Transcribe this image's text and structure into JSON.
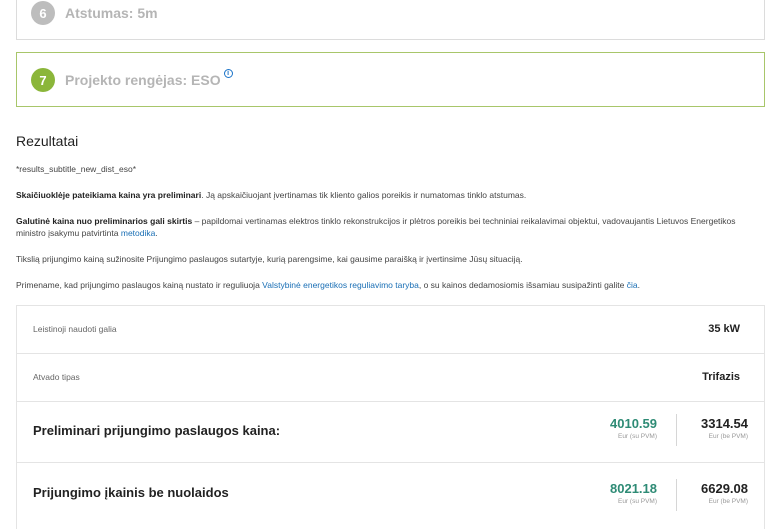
{
  "steps": [
    {
      "number": "6",
      "title": "Atstumas: 5m"
    },
    {
      "number": "7",
      "title": "Projekto rengėjas: ESO",
      "info_icon": "i"
    }
  ],
  "results": {
    "title": "Rezultatai",
    "subtitle": "*results_subtitle_new_dist_eso*",
    "p1_bold": "Skaičiuoklėje pateikiama kaina yra preliminari",
    "p1_text": ". Ją apskaičiuojant įvertinamas tik kliento galios poreikis ir numatomas tinklo atstumas.",
    "p2_bold": "Galutinė kaina nuo preliminarios gali skirtis",
    "p2_text": " – papildomai vertinamas elektros tinklo rekonstrukcijos ir plėtros poreikis bei techniniai reikalavimai objektui, vadovaujantis Lietuvos Energetikos ministro įsakymu patvirtinta ",
    "p2_link": "metodika",
    "p2_end": ".",
    "p3_text": "Tikslią prijungimo kainą sužinosite Prijungimo paslaugos sutartyje, kurią parengsime, kai gausime paraišką ir įvertinsime Jūsų situaciją.",
    "p4_text": "Primename, kad prijungimo paslaugos kainą nustato ir reguliuoja ",
    "p4_link": "Valstybinė energetikos reguliavimo taryba",
    "p4_mid": ", o su kainos dedamosiomis išsamiau susipažinti galite ",
    "p4_link2": "čia",
    "p4_end": "."
  },
  "table": {
    "power_label": "Leistinoji naudoti galia",
    "power_value": "35 kW",
    "input_label": "Atvado tipas",
    "input_value": "Trifazis",
    "prelim_label": "Preliminari prijungimo paslaugos kaina:",
    "prelim_vat": "4010.59",
    "prelim_vat_unit": "Eur (su PVM)",
    "prelim_novat": "3314.54",
    "prelim_novat_unit": "Eur (be PVM)",
    "full_label": "Prijungimo įkainis be nuolaidos",
    "full_vat": "8021.18",
    "full_vat_unit": "Eur (su PVM)",
    "full_novat": "6629.08",
    "full_novat_unit": "Eur (be PVM)"
  },
  "colors": {
    "step_active": "#8bb63a",
    "step_inactive": "#bdbdbd",
    "price_accent": "#2e8b75",
    "link": "#1a6fb5"
  }
}
